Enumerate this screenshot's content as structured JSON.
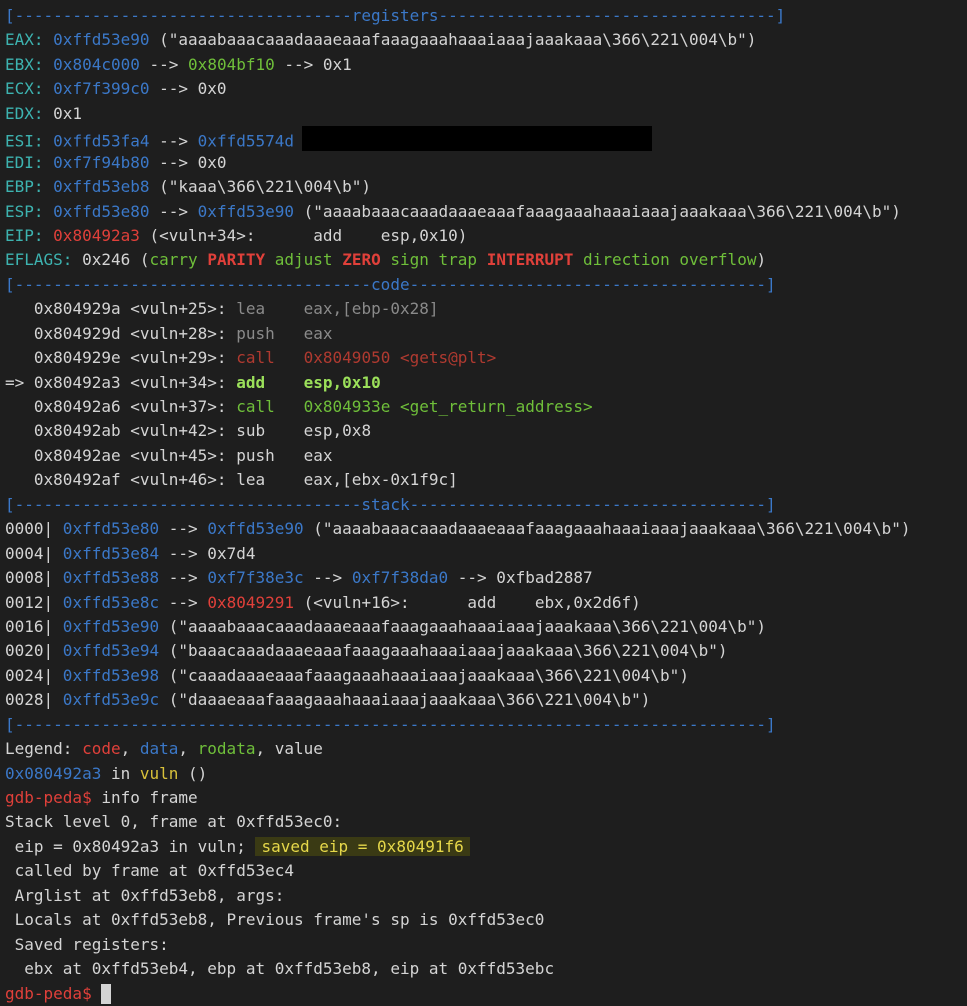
{
  "separators": {
    "registers": "[-----------------------------------registers-----------------------------------]",
    "code": "[-------------------------------------code-------------------------------------]",
    "stack": "[------------------------------------stack-------------------------------------]",
    "end": "[------------------------------------------------------------------------------]"
  },
  "registers": {
    "eax": {
      "label": "EAX:",
      "addr": "0xffd53e90",
      "rest": " (\"aaaabaaacaaadaaaeaaafaaagaaahaaaiaaajaaakaaa\\366\\221\\004\\b\")"
    },
    "ebx": {
      "label": "EBX:",
      "addr1": "0x804c000",
      "arrow1": " --> ",
      "addr2": "0x804bf10",
      "rest": " --> 0x1"
    },
    "ecx": {
      "label": "ECX:",
      "addr": "0xf7f399c0",
      "rest": " --> 0x0"
    },
    "edx": {
      "label": "EDX:",
      "rest": " 0x1"
    },
    "esi": {
      "label": "ESI:",
      "addr1": "0xffd53fa4",
      "arrow": " --> ",
      "addr2": "0xffd5574d"
    },
    "edi": {
      "label": "EDI:",
      "addr": "0xf7f94b80",
      "rest": " --> 0x0"
    },
    "ebp": {
      "label": "EBP:",
      "addr": "0xffd53eb8",
      "rest": " (\"kaaa\\366\\221\\004\\b\")"
    },
    "esp": {
      "label": "ESP:",
      "addr1": "0xffd53e80",
      "arrow": " --> ",
      "addr2": "0xffd53e90",
      "rest": " (\"aaaabaaacaaadaaaeaaafaaagaaahaaaiaaajaaakaaa\\366\\221\\004\\b\")"
    },
    "eip": {
      "label": "EIP:",
      "addr": "0x80492a3",
      "rest": " (<vuln+34>:      add    esp,0x10)"
    },
    "eflags": {
      "label": "EFLAGS:",
      "value": " 0x246 (",
      "flags": [
        "carry",
        "PARITY",
        "adjust",
        "ZERO",
        "sign",
        "trap",
        "INTERRUPT",
        "direction",
        "overflow"
      ],
      "close": ")"
    }
  },
  "code": [
    {
      "prefix": "   ",
      "loc": "0x804929a <vuln+25>: ",
      "op": "lea    ",
      "args": "eax,[ebp-0x28]"
    },
    {
      "prefix": "   ",
      "loc": "0x804929d <vuln+28>: ",
      "op": "push   ",
      "args": "eax"
    },
    {
      "prefix": "   ",
      "loc": "0x804929e <vuln+29>: ",
      "op": "call   ",
      "args": "0x8049050 <gets@plt>"
    },
    {
      "prefix": "=> ",
      "loc": "0x80492a3 <vuln+34>: ",
      "op": "add    ",
      "args": "esp,0x10"
    },
    {
      "prefix": "   ",
      "loc": "0x80492a6 <vuln+37>: ",
      "op": "call   ",
      "args": "0x804933e <get_return_address>"
    },
    {
      "prefix": "   ",
      "loc": "0x80492ab <vuln+42>: ",
      "op": "sub    ",
      "args": "esp,0x8"
    },
    {
      "prefix": "   ",
      "loc": "0x80492ae <vuln+45>: ",
      "op": "push   ",
      "args": "eax"
    },
    {
      "prefix": "   ",
      "loc": "0x80492af <vuln+46>: ",
      "op": "lea    ",
      "args": "eax,[ebx-0x1f9c]"
    }
  ],
  "stack": [
    {
      "off": "0000|",
      "addr": " 0xffd53e80",
      "a": " --> ",
      "b": "0xffd53e90",
      "rest": " (\"aaaabaaacaaadaaaeaaafaaagaaahaaaiaaajaaakaaa\\366\\221\\004\\b\")"
    },
    {
      "off": "0004|",
      "addr": " 0xffd53e84",
      "rest": " --> 0x7d4"
    },
    {
      "off": "0008|",
      "addr": " 0xffd53e88",
      "a": " --> ",
      "b": "0xf7f38e3c",
      "c": " --> ",
      "d": "0xf7f38da0",
      "rest": " --> 0xfbad2887"
    },
    {
      "off": "0012|",
      "addr": " 0xffd53e8c",
      "a": " --> ",
      "code": "0x8049291",
      "rest": " (<vuln+16>:      add    ebx,0x2d6f)"
    },
    {
      "off": "0016|",
      "addr": " 0xffd53e90",
      "rest": " (\"aaaabaaacaaadaaaeaaafaaagaaahaaaiaaajaaakaaa\\366\\221\\004\\b\")"
    },
    {
      "off": "0020|",
      "addr": " 0xffd53e94",
      "rest": " (\"baaacaaadaaaeaaafaaagaaahaaaiaaajaaakaaa\\366\\221\\004\\b\")"
    },
    {
      "off": "0024|",
      "addr": " 0xffd53e98",
      "rest": " (\"caaadaaaeaaafaaagaaahaaaiaaajaaakaaa\\366\\221\\004\\b\")"
    },
    {
      "off": "0028|",
      "addr": " 0xffd53e9c",
      "rest": " (\"daaaeaaafaaagaaahaaaiaaajaaakaaa\\366\\221\\004\\b\")"
    }
  ],
  "legend": {
    "label": "Legend: ",
    "code": "code",
    "sep1": ", ",
    "data": "data",
    "sep2": ", ",
    "rodata": "rodata",
    "tail": ", value"
  },
  "location": {
    "addr": "0x080492a3",
    "mid": " in ",
    "fn": "vuln",
    "tail": " ()"
  },
  "prompt": "gdb-peda$",
  "command": " info frame",
  "frame_info": {
    "line1": "Stack level 0, frame at 0xffd53ec0:",
    "line2_pre": " eip = 0x80492a3 in vuln; ",
    "line2_hl": "saved eip = 0x80491f6",
    "line3": " called by frame at 0xffd53ec4",
    "line4": " Arglist at 0xffd53eb8, args:",
    "line5": " Locals at 0xffd53eb8, Previous frame's sp is 0xffd53ec0",
    "line6": " Saved registers:",
    "line7": "  ebx at 0xffd53eb4, ebp at 0xffd53eb8, eip at 0xffd53ebc"
  },
  "colors": {
    "background": "#1e1e1e",
    "separator": "#3b78c8",
    "register": "#3db3b0",
    "data": "#3b78c8",
    "rodata": "#6fbf3a",
    "code": "#e0403a",
    "highlight": "#3a3a14"
  },
  "icons": {
    "cursor": "block-cursor"
  }
}
